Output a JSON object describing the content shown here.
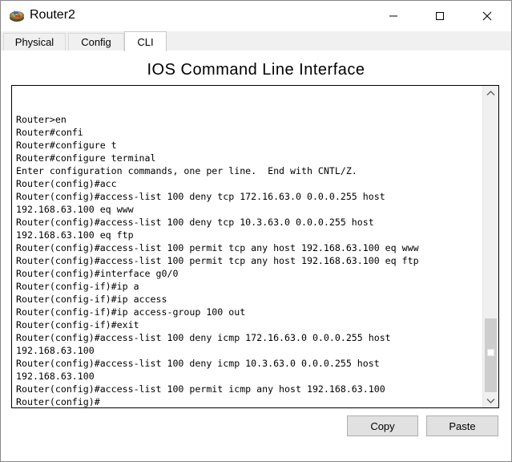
{
  "window": {
    "title": "Router2",
    "app_icon": "router-icon",
    "controls": {
      "minimize_icon": "minimize-icon",
      "maximize_icon": "maximize-icon",
      "close_icon": "close-icon"
    }
  },
  "tabs": [
    {
      "label": "Physical",
      "active": false
    },
    {
      "label": "Config",
      "active": false
    },
    {
      "label": "CLI",
      "active": true
    }
  ],
  "cli": {
    "heading": "IOS Command Line Interface",
    "lines": [
      "Router>en",
      "Router#confi",
      "Router#configure t",
      "Router#configure terminal",
      "Enter configuration commands, one per line.  End with CNTL/Z.",
      "Router(config)#acc",
      "Router(config)#access-list 100 deny tcp 172.16.63.0 0.0.0.255 host",
      "192.168.63.100 eq www",
      "Router(config)#access-list 100 deny tcp 10.3.63.0 0.0.0.255 host",
      "192.168.63.100 eq ftp",
      "Router(config)#access-list 100 permit tcp any host 192.168.63.100 eq www",
      "Router(config)#access-list 100 permit tcp any host 192.168.63.100 eq ftp",
      "Router(config)#interface g0/0",
      "Router(config-if)#ip a",
      "Router(config-if)#ip access",
      "Router(config-if)#ip access-group 100 out",
      "Router(config-if)#exit",
      "Router(config)#access-list 100 deny icmp 172.16.63.0 0.0.0.255 host",
      "192.168.63.100",
      "Router(config)#access-list 100 deny icmp 10.3.63.0 0.0.0.255 host",
      "192.168.63.100",
      "Router(config)#access-list 100 permit icmp any host 192.168.63.100",
      "Router(config)#"
    ]
  },
  "buttons": {
    "copy_label": "Copy",
    "paste_label": "Paste"
  },
  "colors": {
    "title_bar": "#ffffff",
    "window_bg": "#f0f0f0",
    "terminal_bg": "#ffffff",
    "terminal_text": "#000000",
    "button_bg": "#e1e1e1"
  }
}
